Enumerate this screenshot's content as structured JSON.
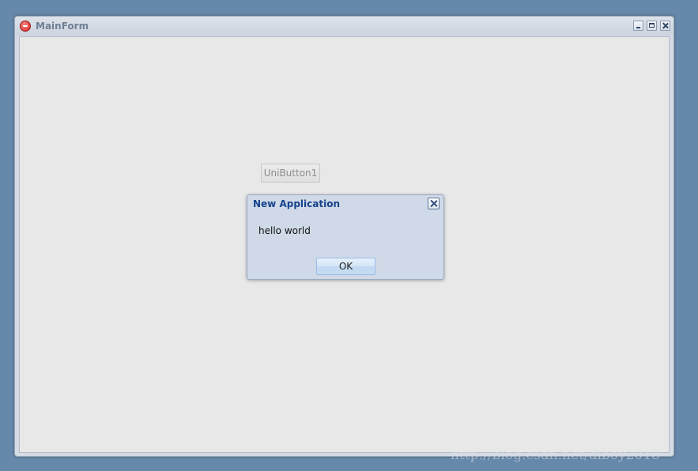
{
  "window": {
    "title": "MainForm",
    "icon": "app-logo-icon",
    "controls": [
      "minimize-icon",
      "maximize-icon",
      "close-icon"
    ]
  },
  "main": {
    "button_label": "UniButton1"
  },
  "dialog": {
    "title": "New Application",
    "message": "hello world",
    "ok_label": "OK",
    "close_icon": "close-icon"
  },
  "watermark": {
    "text": "http://blog.csdn.net/dlboy2018"
  },
  "colors": {
    "desktop": "#6688aa",
    "dialog_title": "#15428b",
    "dialog_bg": "#cfd9e7",
    "client_bg": "#e8e8e8"
  }
}
